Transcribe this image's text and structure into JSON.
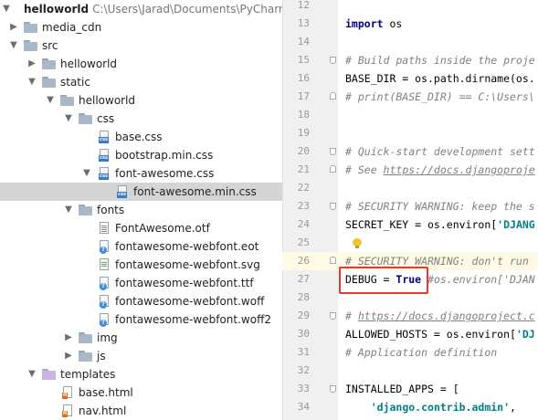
{
  "project_tree": {
    "root_name": "helloworld",
    "root_path": "C:\\Users\\Jarad\\Documents\\PyCharm\\hell",
    "items": [
      {
        "label": "media_cdn"
      },
      {
        "label": "src"
      },
      {
        "label": "helloworld"
      },
      {
        "label": "static"
      },
      {
        "label": "helloworld"
      },
      {
        "label": "css"
      },
      {
        "label": "base.css"
      },
      {
        "label": "bootstrap.min.css"
      },
      {
        "label": "font-awesome.css"
      },
      {
        "label": "font-awesome.min.css"
      },
      {
        "label": "fonts"
      },
      {
        "label": "FontAwesome.otf"
      },
      {
        "label": "fontawesome-webfont.eot"
      },
      {
        "label": "fontawesome-webfont.svg"
      },
      {
        "label": "fontawesome-webfont.ttf"
      },
      {
        "label": "fontawesome-webfont.woff"
      },
      {
        "label": "fontawesome-webfont.woff2"
      },
      {
        "label": "img"
      },
      {
        "label": "js"
      },
      {
        "label": "templates"
      },
      {
        "label": "base.html"
      },
      {
        "label": "nav.html"
      }
    ],
    "icon_tags": {
      "css": "css",
      "html": "H"
    }
  },
  "editor": {
    "line_numbers": [
      "12",
      "13",
      "14",
      "15",
      "16",
      "17",
      "18",
      "19",
      "20",
      "21",
      "22",
      "23",
      "24",
      "25",
      "26",
      "27",
      "28",
      "29",
      "30",
      "31",
      "32",
      "33",
      "34"
    ],
    "lines": {
      "l13_kw": "import",
      "l13_rest": " os",
      "l15": "# Build paths inside the proje",
      "l16": "BASE_DIR = os.path.dirname(os.",
      "l17": "# print(BASE_DIR) == C:\\Users\\",
      "l20": "# Quick-start development sett",
      "l21_pre": "# See ",
      "l21_link": "https://docs.djangoproje",
      "l23": "# SECURITY WARNING: keep the s",
      "l24_pre": "SECRET_KEY = os.environ[",
      "l24_str": "'DJANG",
      "l26": "# SECURITY WARNING: don't run",
      "l27_pre": "DEBUG = ",
      "l27_kw": "True",
      "l27_cmt": " #os.environ['DJAN",
      "l29_pre": "# ",
      "l29_link": "https://docs.djangoproject.c",
      "l30_pre": "ALLOWED_HOSTS = os.environ[",
      "l30_str": "'DJ",
      "l31": "# Application definition",
      "l33": "INSTALLED_APPS = [",
      "l34_indent": "    ",
      "l34_str": "'django.contrib.admin'",
      "l34_rest": ","
    }
  },
  "colors": {
    "keyword": "#000080",
    "comment": "#808080",
    "string": "#008080",
    "selection": "#d5d5d5",
    "highlight_box": "#ee3333"
  }
}
